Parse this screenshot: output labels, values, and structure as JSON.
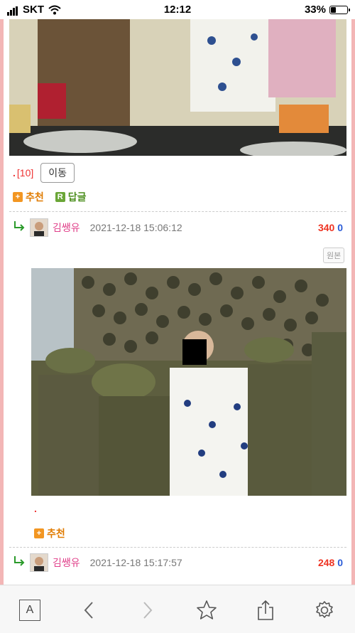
{
  "status": {
    "carrier": "SKT",
    "time": "12:12",
    "battery": "33%",
    "battery_level": 0.33
  },
  "post": {
    "dot": ".",
    "count": "[10]",
    "move_button": "이동"
  },
  "actions": {
    "recommend": "추천",
    "reply": "답글",
    "reply_badge": "R",
    "plus_badge": "+"
  },
  "comments": [
    {
      "nickname": "김쌩유",
      "datetime": "2021-12-18 15:06:12",
      "score_up": "340",
      "score_down": "0",
      "original_label": "원본",
      "dot": ".",
      "recommend": "추천"
    },
    {
      "nickname": "김쌩유",
      "datetime": "2021-12-18 15:17:57",
      "score_up": "248",
      "score_down": "0"
    }
  ],
  "toolbar": {
    "reader": "A"
  },
  "icons": [
    "wifi-icon",
    "battery-icon",
    "reply-arrow-icon",
    "avatar-icon",
    "back-icon",
    "forward-icon",
    "star-icon",
    "share-icon",
    "settings-icon"
  ]
}
